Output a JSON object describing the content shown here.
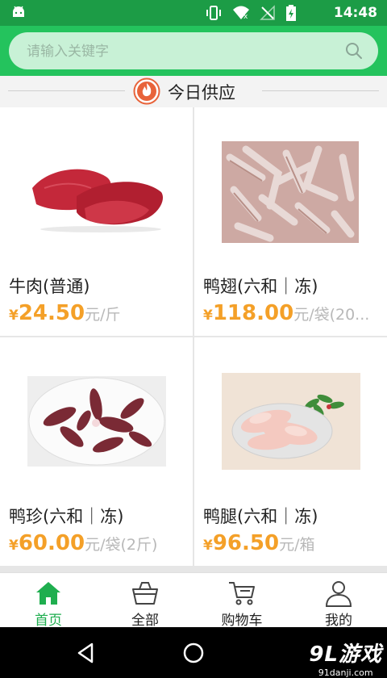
{
  "status_bar": {
    "time": "14:48"
  },
  "search": {
    "placeholder": "请输入关键字"
  },
  "section": {
    "title": "今日供应"
  },
  "products": [
    {
      "name": "牛肉(普通)",
      "currency": "¥",
      "price": "24.50",
      "unit": "元/斤",
      "image": "beef"
    },
    {
      "name": "鸭翅(六和｜冻)",
      "currency": "¥",
      "price": "118.00",
      "unit": "元/袋(20...",
      "image": "duck-wings"
    },
    {
      "name": "鸭珍(六和｜冻)",
      "currency": "¥",
      "price": "60.00",
      "unit": "元/袋(2斤)",
      "image": "duck-gizzards"
    },
    {
      "name": "鸭腿(六和｜冻)",
      "currency": "¥",
      "price": "96.50",
      "unit": "元/箱",
      "image": "duck-legs"
    }
  ],
  "tabs": [
    {
      "label": "首页",
      "icon": "home-icon",
      "active": true
    },
    {
      "label": "全部",
      "icon": "basket-icon",
      "active": false
    },
    {
      "label": "购物车",
      "icon": "cart-icon",
      "active": false
    },
    {
      "label": "我的",
      "icon": "user-icon",
      "active": false
    }
  ],
  "watermark": {
    "brand": "9L游戏",
    "url": "91danji.com"
  },
  "colors": {
    "brand_green": "#24c35d",
    "status_green": "#1c9c46",
    "price_orange": "#f4a028"
  }
}
